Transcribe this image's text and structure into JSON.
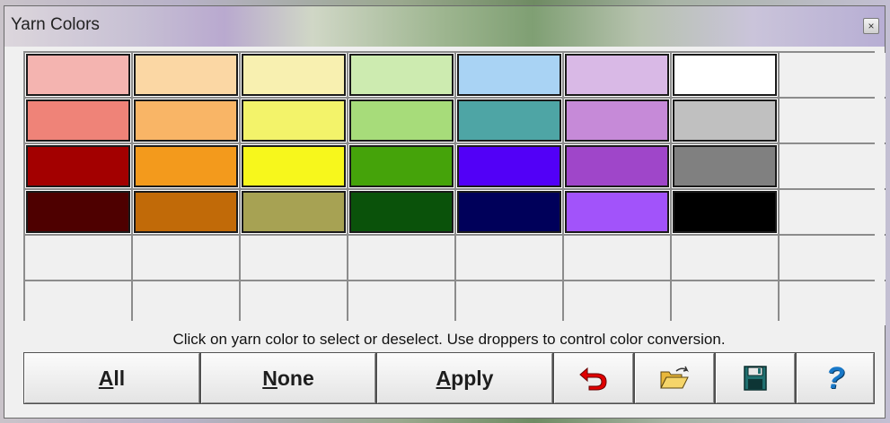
{
  "window": {
    "title": "Yarn Colors",
    "close_glyph": "×"
  },
  "palette": {
    "rows": [
      [
        "#f4b4b0",
        "#fbd7a4",
        "#f8f0b0",
        "#cdebb0",
        "#a9d3f4",
        "#d9b9e6",
        "#ffffff",
        ""
      ],
      [
        "#ef8378",
        "#f9b566",
        "#f3f36a",
        "#a7dc7a",
        "#4ea5a5",
        "#c68ad8",
        "#c0c0c0",
        ""
      ],
      [
        "#a30000",
        "#f39a1c",
        "#f7f71c",
        "#45a30a",
        "#5200f7",
        "#9f46c9",
        "#808080",
        ""
      ],
      [
        "#4e0000",
        "#c16a08",
        "#a7a253",
        "#0a520a",
        "#00005a",
        "#a253fa",
        "#000000",
        ""
      ],
      [
        "",
        "",
        "",
        "",
        "",
        "",
        "",
        ""
      ],
      [
        "",
        "",
        "",
        "",
        "",
        "",
        "",
        ""
      ]
    ]
  },
  "hint": "Click on yarn color to select or deselect. Use droppers to control color conversion.",
  "buttons": {
    "all": {
      "mnemonic": "A",
      "rest": "ll"
    },
    "none": {
      "mnemonic": "N",
      "rest": "one"
    },
    "apply": {
      "mnemonic": "A",
      "rest": "pply"
    },
    "undo_icon": "undo-arrow-icon",
    "open_icon": "open-folder-icon",
    "save_icon": "floppy-disk-icon",
    "help_icon": "question-mark-icon",
    "help_glyph": "?"
  },
  "colors": {
    "undo_red": "#e00000",
    "help_blue": "#1878c8",
    "save_teal": "#1f6f6f",
    "folder_yellow": "#f2c94c"
  }
}
